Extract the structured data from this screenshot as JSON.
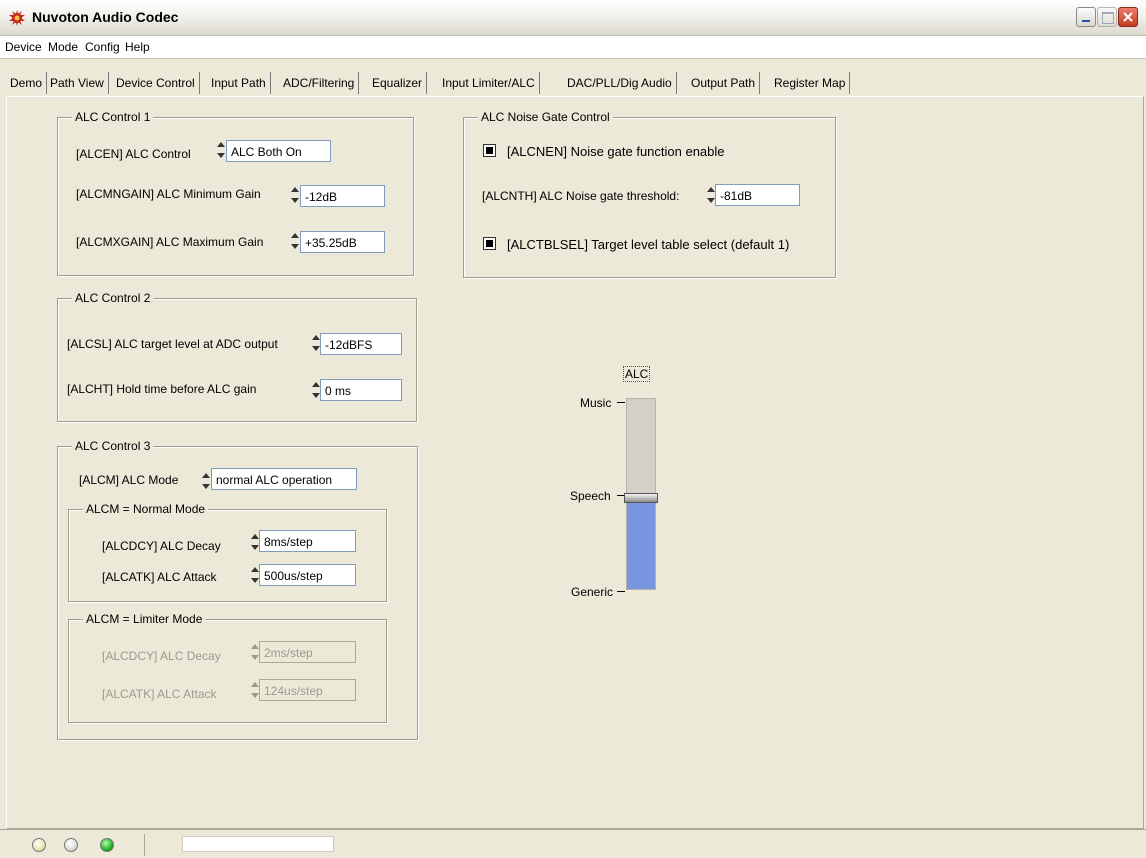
{
  "window": {
    "title": "Nuvoton Audio Codec"
  },
  "menu": [
    "Device",
    "Mode",
    "Config",
    "Help"
  ],
  "tabs": [
    "Demo",
    "Path View",
    "Device Control",
    "Input Path",
    "ADC/Filtering",
    "Equalizer",
    "Input Limiter/ALC",
    "DAC/PLL/Dig Audio",
    "Output Path",
    "Register Map"
  ],
  "active_tab": "Input Limiter/ALC",
  "alc1": {
    "title": "ALC Control 1",
    "alcen_label": "[ALCEN] ALC Control",
    "alcen_value": "ALC Both On",
    "mngain_label": "[ALCMNGAIN] ALC Minimum Gain",
    "mngain_value": "-12dB",
    "mxgain_label": "[ALCMXGAIN] ALC Maximum Gain",
    "mxgain_value": "+35.25dB"
  },
  "alc2": {
    "title": "ALC Control 2",
    "alcsl_label": "[ALCSL] ALC target level at ADC output",
    "alcsl_value": "-12dBFS",
    "alcht_label": "[ALCHT] Hold time before ALC gain",
    "alcht_value": "0 ms"
  },
  "alc3": {
    "title": "ALC Control 3",
    "alcm_label": "[ALCM] ALC Mode",
    "alcm_value": "normal ALC operation",
    "normal": {
      "title": "ALCM = Normal Mode",
      "decay_label": "[ALCDCY] ALC Decay",
      "decay_value": "8ms/step",
      "attack_label": "[ALCATK] ALC Attack",
      "attack_value": "500us/step"
    },
    "limiter": {
      "title": "ALCM = Limiter Mode",
      "decay_label": "[ALCDCY] ALC Decay",
      "decay_value": "2ms/step",
      "attack_label": "[ALCATK] ALC Attack",
      "attack_value": "124us/step"
    }
  },
  "noise_gate": {
    "title": "ALC Noise Gate Control",
    "enable_label": "[ALCNEN]  Noise gate function enable",
    "enable_checked": true,
    "threshold_label": "[ALCNTH] ALC Noise gate threshold:",
    "threshold_value": "-81dB",
    "tblsel_label": "[ALCTBLSEL]  Target level table select (default 1)",
    "tblsel_checked": true
  },
  "alc_slider": {
    "label": "ALC",
    "ticks": [
      "Music",
      "Speech",
      "Generic"
    ],
    "selected": "Speech",
    "level_fraction": 0.48,
    "fill_color": "#7b96e0"
  },
  "status": {
    "leds": [
      "off",
      "off",
      "green"
    ]
  }
}
